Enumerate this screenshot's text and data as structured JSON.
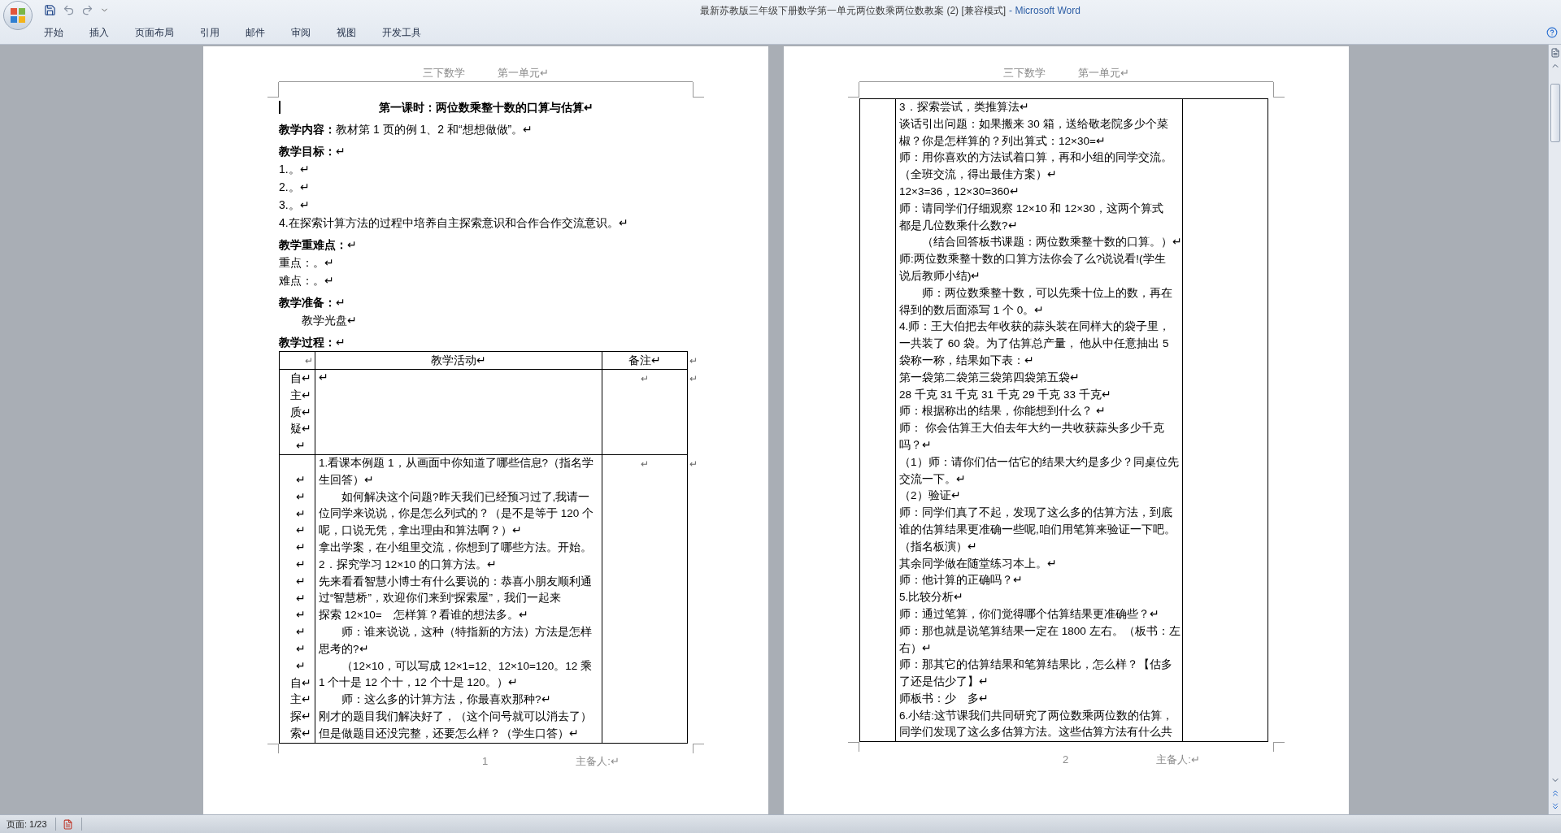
{
  "window": {
    "title": "最新苏教版三年级下册数学第一单元两位数乘两位数教案 (2) [兼容模式]",
    "app_name": "- Microsoft Word"
  },
  "ribbon_tabs": [
    "开始",
    "插入",
    "页面布局",
    "引用",
    "邮件",
    "审阅",
    "视图",
    "开发工具"
  ],
  "pages": [
    {
      "header": {
        "left": "三下数学",
        "right": "第一单元↵"
      },
      "blocks": [
        {
          "kind": "title",
          "text": "第一课时：两位数乘整十数的口算与估算↵",
          "cursor": true
        },
        {
          "kind": "heading",
          "text": "**教学内容：**教材第 1 页的例 1、2 和“想想做做”。↵"
        },
        {
          "kind": "heading",
          "text": "**教学目标：**↵"
        },
        {
          "kind": "para",
          "text": "1.。↵"
        },
        {
          "kind": "para",
          "text": "2.。↵"
        },
        {
          "kind": "para",
          "text": "3.。↵"
        },
        {
          "kind": "para",
          "text": "4.在探索计算方法的过程中培养自主探索意识和合作合作交流意识。↵"
        },
        {
          "kind": "heading",
          "text": "**教学重难点：**↵"
        },
        {
          "kind": "para",
          "text": "重点：。↵"
        },
        {
          "kind": "para",
          "text": "难点：。↵"
        },
        {
          "kind": "heading",
          "text": "**教学准备：**↵"
        },
        {
          "kind": "indent",
          "text": "教学光盘↵"
        },
        {
          "kind": "heading",
          "text": "**教学过程：**↵"
        }
      ],
      "table": {
        "header": [
          "↵",
          "教学活动↵",
          "备注↵"
        ],
        "header_end": "↵",
        "rows": [
          {
            "col_1": [
              "自↵",
              "主↵",
              "质↵",
              "疑↵",
              "↵"
            ],
            "activity": [
              {
                "kind": "para",
                "lines": [
                  "↵"
                ]
              }
            ],
            "notes": "↵",
            "row_end": "↵"
          },
          {
            "col_1": [
              "↵",
              "↵",
              "↵",
              "↵",
              "↵",
              "↵",
              "↵",
              "↵",
              "↵",
              "↵",
              "↵",
              "↵",
              "自↵",
              "主↵",
              "探↵",
              "索↵"
            ],
            "activity": [
              {
                "kind": "para",
                "lines": [
                  "1.看课本例题 1，从画面中你知道了哪些信息?（指名学",
                  "生回答）↵"
                ]
              },
              {
                "kind": "indent",
                "lines": [
                  "如何解决这个问题?昨天我们已经预习过了,我请一",
                  "位同学来说说，你是怎么列式的？（是不是等于 120 个",
                  "呢，口说无凭，拿出理由和算法啊？）↵"
                ]
              },
              {
                "kind": "para",
                "lines": [
                  "拿出学案，在小组里交流，你想到了哪些方法。开始。"
                ]
              },
              {
                "kind": "para",
                "lines": [
                  "2．探究学习 12×10 的口算方法。↵"
                ]
              },
              {
                "kind": "para",
                "lines": [
                  "先来看看智慧小博士有什么要说的：恭喜小朋友顺利通",
                  "过“智慧桥”，欢迎你们来到“探索屋”，我们一起来",
                  "探索 12×10=　怎样算？看谁的想法多。↵"
                ]
              },
              {
                "kind": "indent",
                "lines": [
                  "师：谁来说说，这种（特指新的方法）方法是怎样",
                  "思考的?↵"
                ]
              },
              {
                "kind": "indent",
                "lines": [
                  "（12×10，可以写成 12×1=12、12×10=120。12 乘",
                  "1 个十是 12 个十，12 个十是 120。）↵"
                ]
              },
              {
                "kind": "indent",
                "lines": [
                  "师：这么多的计算方法，你最喜欢那种?↵"
                ]
              },
              {
                "kind": "para",
                "lines": [
                  "刚才的题目我们解决好了，（这个问号就可以消去了）",
                  "但是做题目还没完整，还要怎么样？（学生口答）↵"
                ]
              }
            ],
            "notes": "↵",
            "row_end": "↵"
          }
        ]
      },
      "footer": {
        "page_number": "1",
        "author": "主备人:↵"
      }
    },
    {
      "header": {
        "left": "三下数学",
        "right": "第一单元↵"
      },
      "table": {
        "rows": [
          {
            "activity": [
              {
                "kind": "para",
                "lines": [
                  "3．探索尝试，类推算法↵"
                ]
              },
              {
                "kind": "para",
                "lines": [
                  "谈话引出问题：如果搬来 30 箱，送给敬老院多少个菜",
                  "椒？你是怎样算的？列出算式：12×30=↵"
                ]
              },
              {
                "kind": "para",
                "lines": [
                  "师：用你喜欢的方法试着口算，再和小组的同学交流。",
                  "（全班交流，得出最佳方案）↵"
                ]
              },
              {
                "kind": "para",
                "lines": [
                  "12×3=36，12×30=360↵"
                ]
              },
              {
                "kind": "para",
                "lines": [
                  "师：请同学们仔细观察 12×10 和 12×30，这两个算式",
                  "都是几位数乘什么数?↵"
                ]
              },
              {
                "kind": "indent",
                "lines": [
                  "（结合回答板书课题：两位数乘整十数的口算。）↵"
                ]
              },
              {
                "kind": "para",
                "lines": [
                  "师:两位数乘整十数的口算方法你会了么?说说看!(学生",
                  "说后教师小结)↵"
                ]
              },
              {
                "kind": "indent",
                "lines": [
                  "师：两位数乘整十数，可以先乘十位上的数，再在",
                  "得到的数后面添写 1 个 0。↵"
                ]
              },
              {
                "kind": "para",
                "lines": [
                  "4.师：王大伯把去年收获的蒜头装在同样大的袋子里，",
                  "一共装了 60 袋。为了估算总产量， 他从中任意抽出 5",
                  "袋称一称，结果如下表：↵"
                ]
              },
              {
                "kind": "para",
                "lines": [
                  "第一袋第二袋第三袋第四袋第五袋↵"
                ]
              },
              {
                "kind": "para",
                "lines": [
                  "28 千克 31 千克 31 千克 29 千克 33 千克↵"
                ]
              },
              {
                "kind": "para",
                "lines": [
                  "师：根据称出的结果，你能想到什么？ ↵"
                ]
              },
              {
                "kind": "para",
                "lines": [
                  "师：  你会估算王大伯去年大约一共收获蒜头多少千克",
                  "吗？↵"
                ]
              },
              {
                "kind": "para",
                "lines": [
                  "（1）师：请你们估一估它的结果大约是多少？同桌位先",
                  "交流一下。↵"
                ]
              },
              {
                "kind": "para",
                "lines": [
                  "（2）验证↵"
                ]
              },
              {
                "kind": "para",
                "lines": [
                  "师：同学们真了不起，发现了这么多的估算方法，到底",
                  "谁的估算结果更准确一些呢,咱们用笔算来验证一下吧。",
                  "（指名板演）↵"
                ]
              },
              {
                "kind": "para",
                "lines": [
                  "其余同学做在随堂练习本上。↵"
                ]
              },
              {
                "kind": "para",
                "lines": [
                  "师：他计算的正确吗？↵"
                ]
              },
              {
                "kind": "para",
                "lines": [
                  "5.比较分析↵"
                ]
              },
              {
                "kind": "para",
                "lines": [
                  "师：通过笔算，你们觉得哪个估算结果更准确些？↵"
                ]
              },
              {
                "kind": "para",
                "lines": [
                  "师：那也就是说笔算结果一定在 1800 左右。（板书：左",
                  "右）↵"
                ]
              },
              {
                "kind": "para",
                "lines": [
                  "师：那其它的估算结果和笔算结果比，怎么样？【估多",
                  "了还是估少了】↵"
                ]
              },
              {
                "kind": "para",
                "lines": [
                  "师板书：少　多↵"
                ]
              },
              {
                "kind": "para",
                "lines": [
                  "6.小结:这节课我们共同研究了两位数乘两位数的估算，",
                  "同学们发现了这么多估算方法。这些估算方法有什么共"
                ]
              }
            ]
          }
        ]
      },
      "footer": {
        "page_number": "2",
        "author": "主备人:↵"
      }
    }
  ],
  "status_bar": {
    "page": "页面: 1/23"
  }
}
